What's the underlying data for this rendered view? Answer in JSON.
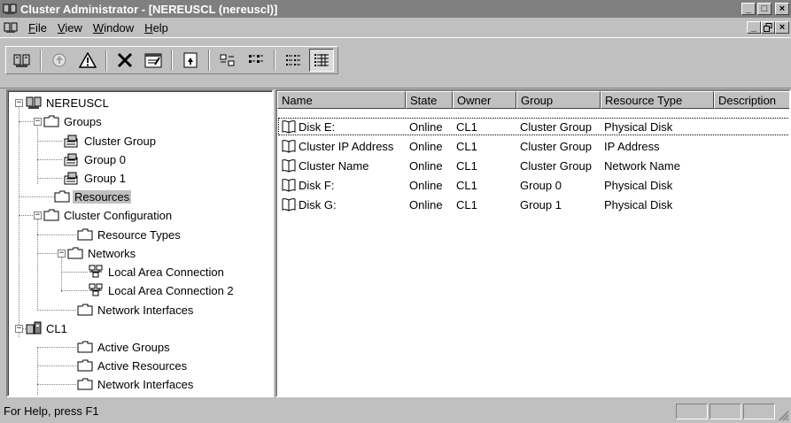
{
  "window": {
    "title": "Cluster Administrator - [NEREUSCL (nereuscl)]",
    "minimize": "_",
    "maximize": "□",
    "close": "×"
  },
  "menu": {
    "items": [
      {
        "label": "File",
        "accel": "F",
        "rest": "ile"
      },
      {
        "label": "View",
        "accel": "V",
        "rest": "iew"
      },
      {
        "label": "Window",
        "accel": "W",
        "rest": "indow"
      },
      {
        "label": "Help",
        "accel": "H",
        "rest": "elp"
      }
    ],
    "mdi_minimize": "_",
    "mdi_restore": "ᴿ",
    "mdi_close": "×"
  },
  "toolbar": {
    "buttons": [
      "open-connection-icon",
      "bring-online-icon",
      "take-offline-icon",
      "delete-icon",
      "properties-icon",
      "refresh-icon",
      "large-icons-icon",
      "small-icons-icon",
      "list-view-icon",
      "details-view-icon"
    ],
    "pressed": "details-view-icon"
  },
  "tree": {
    "root": "NEREUSCL",
    "groups": "Groups",
    "cluster_group": "Cluster Group",
    "group0": "Group 0",
    "group1": "Group 1",
    "resources": "Resources",
    "cluster_config": "Cluster Configuration",
    "resource_types": "Resource Types",
    "networks": "Networks",
    "lan1": "Local Area Connection",
    "lan2": "Local Area Connection 2",
    "network_interfaces": "Network Interfaces",
    "node": "CL1",
    "active_groups": "Active Groups",
    "active_resources": "Active Resources",
    "node_network_interfaces": "Network Interfaces",
    "selected": "Resources"
  },
  "list": {
    "columns": [
      "Name",
      "State",
      "Owner",
      "Group",
      "Resource Type",
      "Description"
    ],
    "rows": [
      {
        "name": "Disk E:",
        "state": "Online",
        "owner": "CL1",
        "group": "Cluster Group",
        "type": "Physical Disk",
        "description": ""
      },
      {
        "name": "Cluster IP Address",
        "state": "Online",
        "owner": "CL1",
        "group": "Cluster Group",
        "type": "IP Address",
        "description": ""
      },
      {
        "name": "Cluster Name",
        "state": "Online",
        "owner": "CL1",
        "group": "Cluster Group",
        "type": "Network Name",
        "description": ""
      },
      {
        "name": "Disk F:",
        "state": "Online",
        "owner": "CL1",
        "group": "Group 0",
        "type": "Physical Disk",
        "description": ""
      },
      {
        "name": "Disk G:",
        "state": "Online",
        "owner": "CL1",
        "group": "Group 1",
        "type": "Physical Disk",
        "description": ""
      }
    ],
    "focused_row": 0
  },
  "status": {
    "text": "For Help, press F1"
  }
}
